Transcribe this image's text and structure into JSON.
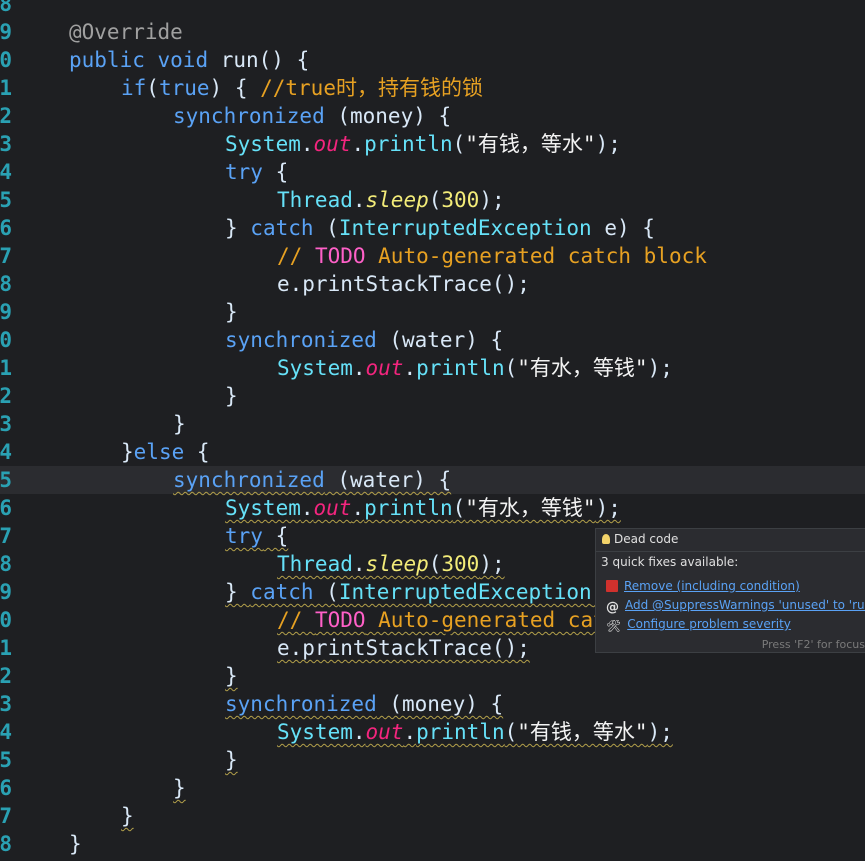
{
  "editor": {
    "lines": [
      {
        "n": "8",
        "indent": 0,
        "tokens": []
      },
      {
        "n": "9",
        "indent": 2,
        "tokens": [
          {
            "c": "ann",
            "t": "@Override"
          }
        ]
      },
      {
        "n": "0",
        "indent": 2,
        "tokens": [
          {
            "c": "kw",
            "t": "public"
          },
          {
            "c": "plain",
            "t": " "
          },
          {
            "c": "kw",
            "t": "void"
          },
          {
            "c": "plain",
            "t": " run() {"
          }
        ]
      },
      {
        "n": "1",
        "indent": 4,
        "tokens": [
          {
            "c": "kw",
            "t": "if"
          },
          {
            "c": "plain",
            "t": "("
          },
          {
            "c": "kw",
            "t": "true"
          },
          {
            "c": "plain",
            "t": ") { "
          },
          {
            "c": "comment",
            "t": "//true时，持有钱的锁"
          }
        ]
      },
      {
        "n": "2",
        "indent": 6,
        "tokens": [
          {
            "c": "kw",
            "t": "synchronized"
          },
          {
            "c": "plain",
            "t": " (money) {"
          }
        ]
      },
      {
        "n": "3",
        "indent": 8,
        "tokens": [
          {
            "c": "type",
            "t": "System"
          },
          {
            "c": "plain",
            "t": "."
          },
          {
            "c": "field",
            "t": "out"
          },
          {
            "c": "plain",
            "t": "."
          },
          {
            "c": "type",
            "t": "println"
          },
          {
            "c": "plain",
            "t": "("
          },
          {
            "c": "str",
            "t": "\"有钱，等水\""
          },
          {
            "c": "plain",
            "t": ");"
          }
        ]
      },
      {
        "n": "4",
        "indent": 8,
        "tokens": [
          {
            "c": "kw",
            "t": "try"
          },
          {
            "c": "plain",
            "t": " {"
          }
        ]
      },
      {
        "n": "5",
        "indent": 10,
        "tokens": [
          {
            "c": "type",
            "t": "Thread"
          },
          {
            "c": "plain",
            "t": "."
          },
          {
            "c": "static",
            "t": "sleep"
          },
          {
            "c": "plain",
            "t": "("
          },
          {
            "c": "num",
            "t": "300"
          },
          {
            "c": "plain",
            "t": ");"
          }
        ]
      },
      {
        "n": "6",
        "indent": 8,
        "tokens": [
          {
            "c": "plain",
            "t": "} "
          },
          {
            "c": "kw",
            "t": "catch"
          },
          {
            "c": "plain",
            "t": " ("
          },
          {
            "c": "type",
            "t": "InterruptedException"
          },
          {
            "c": "plain",
            "t": " e) {"
          }
        ]
      },
      {
        "n": "7",
        "indent": 10,
        "tokens": [
          {
            "c": "comment",
            "t": "// "
          },
          {
            "c": "todo",
            "t": "TODO"
          },
          {
            "c": "comment",
            "t": " Auto-generated catch block"
          }
        ]
      },
      {
        "n": "8",
        "indent": 10,
        "tokens": [
          {
            "c": "plain",
            "t": "e.printStackTrace();"
          }
        ]
      },
      {
        "n": "9",
        "indent": 8,
        "tokens": [
          {
            "c": "plain",
            "t": "}"
          }
        ]
      },
      {
        "n": "0",
        "indent": 8,
        "tokens": [
          {
            "c": "kw",
            "t": "synchronized"
          },
          {
            "c": "plain",
            "t": " (water) {"
          }
        ]
      },
      {
        "n": "1",
        "indent": 10,
        "tokens": [
          {
            "c": "type",
            "t": "System"
          },
          {
            "c": "plain",
            "t": "."
          },
          {
            "c": "field",
            "t": "out"
          },
          {
            "c": "plain",
            "t": "."
          },
          {
            "c": "type",
            "t": "println"
          },
          {
            "c": "plain",
            "t": "("
          },
          {
            "c": "str",
            "t": "\"有水，等钱\""
          },
          {
            "c": "plain",
            "t": ");"
          }
        ]
      },
      {
        "n": "2",
        "indent": 8,
        "tokens": [
          {
            "c": "plain",
            "t": "}"
          }
        ]
      },
      {
        "n": "3",
        "indent": 6,
        "tokens": [
          {
            "c": "plain",
            "t": "}"
          }
        ]
      },
      {
        "n": "4",
        "indent": 4,
        "tokens": [
          {
            "c": "plain",
            "t": "}"
          },
          {
            "c": "kw",
            "t": "else"
          },
          {
            "c": "plain",
            "t": " {"
          }
        ]
      },
      {
        "n": "5",
        "indent": 6,
        "dead": true,
        "current": true,
        "tokens": [
          {
            "c": "kw",
            "t": "synchronized"
          },
          {
            "c": "plain",
            "t": " (water) {"
          }
        ]
      },
      {
        "n": "6",
        "indent": 8,
        "dead": true,
        "tokens": [
          {
            "c": "type",
            "t": "System"
          },
          {
            "c": "plain",
            "t": "."
          },
          {
            "c": "field",
            "t": "out"
          },
          {
            "c": "plain",
            "t": "."
          },
          {
            "c": "type",
            "t": "println"
          },
          {
            "c": "plain",
            "t": "("
          },
          {
            "c": "str",
            "t": "\"有水，等钱\""
          },
          {
            "c": "plain",
            "t": ");"
          }
        ]
      },
      {
        "n": "7",
        "indent": 8,
        "dead": true,
        "tokens": [
          {
            "c": "kw",
            "t": "try"
          },
          {
            "c": "plain",
            "t": " {"
          }
        ]
      },
      {
        "n": "8",
        "indent": 10,
        "dead": true,
        "tokens": [
          {
            "c": "type",
            "t": "Thread"
          },
          {
            "c": "plain",
            "t": "."
          },
          {
            "c": "static",
            "t": "sleep"
          },
          {
            "c": "plain",
            "t": "("
          },
          {
            "c": "num",
            "t": "300"
          },
          {
            "c": "plain",
            "t": ");"
          }
        ]
      },
      {
        "n": "9",
        "indent": 8,
        "dead": true,
        "tokens": [
          {
            "c": "plain",
            "t": "} "
          },
          {
            "c": "kw",
            "t": "catch"
          },
          {
            "c": "plain",
            "t": " ("
          },
          {
            "c": "type",
            "t": "InterruptedException"
          },
          {
            "c": "plain",
            "t": " e) {"
          }
        ]
      },
      {
        "n": "0",
        "indent": 10,
        "dead": true,
        "tokens": [
          {
            "c": "comment",
            "t": "// "
          },
          {
            "c": "todo",
            "t": "TODO"
          },
          {
            "c": "comment",
            "t": " Auto-generated catch block"
          }
        ]
      },
      {
        "n": "1",
        "indent": 10,
        "dead": true,
        "tokens": [
          {
            "c": "plain",
            "t": "e.printStackTrace();"
          }
        ]
      },
      {
        "n": "2",
        "indent": 8,
        "dead": true,
        "tokens": [
          {
            "c": "plain",
            "t": "}"
          }
        ]
      },
      {
        "n": "3",
        "indent": 8,
        "dead": true,
        "tokens": [
          {
            "c": "kw",
            "t": "synchronized"
          },
          {
            "c": "plain",
            "t": " (money) {"
          }
        ]
      },
      {
        "n": "4",
        "indent": 10,
        "dead": true,
        "tokens": [
          {
            "c": "type",
            "t": "System"
          },
          {
            "c": "plain",
            "t": "."
          },
          {
            "c": "field",
            "t": "out"
          },
          {
            "c": "plain",
            "t": "."
          },
          {
            "c": "type",
            "t": "println"
          },
          {
            "c": "plain",
            "t": "("
          },
          {
            "c": "str",
            "t": "\"有钱，等水\""
          },
          {
            "c": "plain",
            "t": ");"
          }
        ]
      },
      {
        "n": "5",
        "indent": 8,
        "dead": true,
        "tokens": [
          {
            "c": "plain",
            "t": "}"
          }
        ]
      },
      {
        "n": "6",
        "indent": 6,
        "dead": true,
        "tokens": [
          {
            "c": "plain",
            "t": "}"
          }
        ]
      },
      {
        "n": "7",
        "indent": 4,
        "dead": true,
        "tokens": [
          {
            "c": "plain",
            "t": "}"
          }
        ]
      },
      {
        "n": "8",
        "indent": 2,
        "tokens": [
          {
            "c": "plain",
            "t": "}"
          }
        ]
      }
    ],
    "colors": {
      "background": "#1e1f22",
      "line_number": "#2aa1b3",
      "keyword": "#5aa2f5",
      "type": "#66e1f8",
      "field": "#f3257e",
      "static_method": "#f3ec79",
      "comment": "#e7a122",
      "todo": "#ff60c8",
      "warning_squiggle": "#b3a04a"
    }
  },
  "hover": {
    "icon": "lightbulb-icon",
    "title": "Dead code",
    "summary": "3 quick fixes available:",
    "fixes": [
      {
        "icon": "remove-icon",
        "label": "Remove (including condition)"
      },
      {
        "icon": "at-sign-icon",
        "label": "Add @SuppressWarnings 'unused' to 'run'"
      },
      {
        "icon": "wrench-icon",
        "label": "Configure problem severity"
      }
    ],
    "footer": "Press 'F2' for focus"
  }
}
